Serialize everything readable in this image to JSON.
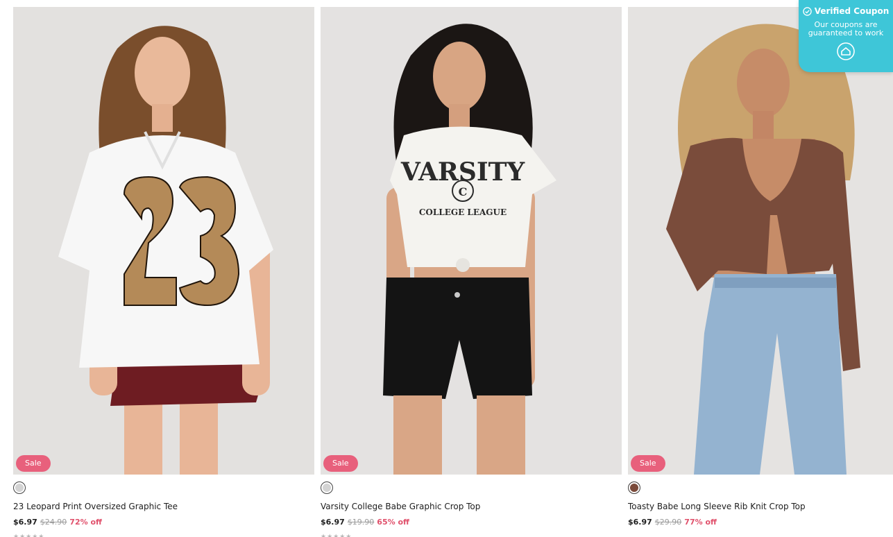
{
  "products": [
    {
      "badge": "Sale",
      "swatch_color": "#d3d3d3",
      "title": "23 Leopard Print Oversized Graphic Tee",
      "price": "$6.97",
      "original_price": "$24.90",
      "discount": "72% off",
      "rating_stars": "★★★★★"
    },
    {
      "badge": "Sale",
      "swatch_color": "#d3d3d3",
      "title": "Varsity College Babe Graphic Crop Top",
      "price": "$6.97",
      "original_price": "$19.90",
      "discount": "65% off",
      "rating_stars": "★★★★★"
    },
    {
      "badge": "Sale",
      "swatch_color": "#7a4a3a",
      "title": "Toasty Babe Long Sleeve Rib Knit Crop Top",
      "price": "$6.97",
      "original_price": "$29.90",
      "discount": "77% off",
      "rating_stars": ""
    }
  ],
  "coupon": {
    "title": "Verified Coupon",
    "subtitle": "Our coupons are guaranteed to work",
    "icon": "home-icon",
    "check_icon": "check-circle-icon"
  },
  "colors": {
    "sale_badge": "#e8607c",
    "discount_text": "#e0506b",
    "coupon_bg": "#3ec6d8"
  }
}
